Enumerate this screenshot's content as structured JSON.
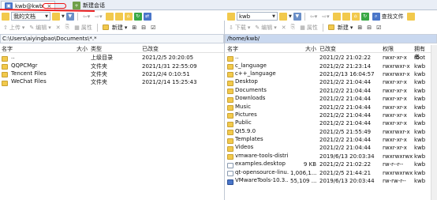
{
  "tabs": [
    {
      "label": "kwb@kwb",
      "active": true
    },
    {
      "label": "新建会话",
      "active": false
    }
  ],
  "left": {
    "toolbar1": {
      "my_docs": "我的文档"
    },
    "toolbar2": {
      "upload": "上传",
      "edit": "编辑",
      "properties": "属性",
      "new": "新建"
    },
    "path": "C:\\Users\\aiyingbao\\Documents\\*.*",
    "columns": [
      "名字",
      "大小",
      "类型",
      "已改变"
    ],
    "rows": [
      {
        "name": "..",
        "size": "",
        "type": "上级目录",
        "changed": "2021/2/5  20:20:05",
        "icon": "upd"
      },
      {
        "name": "QQPCMgr",
        "size": "",
        "type": "文件夹",
        "changed": "2021/1/31  22:55:09",
        "icon": "folder"
      },
      {
        "name": "Tencent Files",
        "size": "",
        "type": "文件夹",
        "changed": "2021/2/4  0:10:51",
        "icon": "folder"
      },
      {
        "name": "WeChat Files",
        "size": "",
        "type": "文件夹",
        "changed": "2021/2/14  15:25:43",
        "icon": "folder"
      }
    ]
  },
  "right": {
    "toolbar1": {
      "dir": "kwb",
      "find_files": "查找文件"
    },
    "toolbar2": {
      "download": "下载",
      "edit": "编辑",
      "properties": "属性",
      "new": "新建"
    },
    "path": "/home/kwb/",
    "columns": [
      "名字",
      "大小",
      "已改变",
      "权限",
      "拥有者"
    ],
    "rows": [
      {
        "name": "..",
        "size": "",
        "changed": "2021/2/2 21:02:22",
        "perm": "rwxr-xr-x",
        "owner": "root",
        "icon": "upd"
      },
      {
        "name": "c_language",
        "size": "",
        "changed": "2021/2/2 21:23:14",
        "perm": "rwxrwxr-x",
        "owner": "kwb",
        "icon": "folder"
      },
      {
        "name": "c++_language",
        "size": "",
        "changed": "2021/2/13 16:04:57",
        "perm": "rwxrwxr-x",
        "owner": "kwb",
        "icon": "folder"
      },
      {
        "name": "Desktop",
        "size": "",
        "changed": "2021/2/2 21:04:44",
        "perm": "rwxr-xr-x",
        "owner": "kwb",
        "icon": "folder"
      },
      {
        "name": "Documents",
        "size": "",
        "changed": "2021/2/2 21:04:44",
        "perm": "rwxr-xr-x",
        "owner": "kwb",
        "icon": "folder"
      },
      {
        "name": "Downloads",
        "size": "",
        "changed": "2021/2/2 21:04:44",
        "perm": "rwxr-xr-x",
        "owner": "kwb",
        "icon": "folder"
      },
      {
        "name": "Music",
        "size": "",
        "changed": "2021/2/2 21:04:44",
        "perm": "rwxr-xr-x",
        "owner": "kwb",
        "icon": "folder"
      },
      {
        "name": "Pictures",
        "size": "",
        "changed": "2021/2/2 21:04:44",
        "perm": "rwxr-xr-x",
        "owner": "kwb",
        "icon": "folder"
      },
      {
        "name": "Public",
        "size": "",
        "changed": "2021/2/2 21:04:44",
        "perm": "rwxr-xr-x",
        "owner": "kwb",
        "icon": "folder"
      },
      {
        "name": "Qt5.9.0",
        "size": "",
        "changed": "2021/2/5 21:55:49",
        "perm": "rwxrwxr-x",
        "owner": "kwb",
        "icon": "folder"
      },
      {
        "name": "Templates",
        "size": "",
        "changed": "2021/2/2 21:04:44",
        "perm": "rwxr-xr-x",
        "owner": "kwb",
        "icon": "folder"
      },
      {
        "name": "Videos",
        "size": "",
        "changed": "2021/2/2 21:04:44",
        "perm": "rwxr-xr-x",
        "owner": "kwb",
        "icon": "folder"
      },
      {
        "name": "vmware-tools-distrib",
        "size": "",
        "changed": "2019/6/13 20:03:34",
        "perm": "rwxrwxrwx",
        "owner": "kwb",
        "icon": "folder"
      },
      {
        "name": "examples.desktop",
        "size": "9 KB",
        "changed": "2021/2/2 21:02:22",
        "perm": "rw-r--r--",
        "owner": "kwb",
        "icon": "file"
      },
      {
        "name": "qt-opensource-linu...",
        "size": "1,006,1...",
        "changed": "2021/2/5 21:44:21",
        "perm": "rwxrwxrwx",
        "owner": "kwb",
        "icon": "file"
      },
      {
        "name": "VMwareTools-10.3....",
        "size": "55,109 ...",
        "changed": "2019/6/13 20:03:44",
        "perm": "rw-rw-r--",
        "owner": "kwb",
        "icon": "vm"
      }
    ]
  },
  "colors": {
    "folder": "#f2c94c",
    "accent": "#4a76c9",
    "scribble": "#e11111"
  }
}
